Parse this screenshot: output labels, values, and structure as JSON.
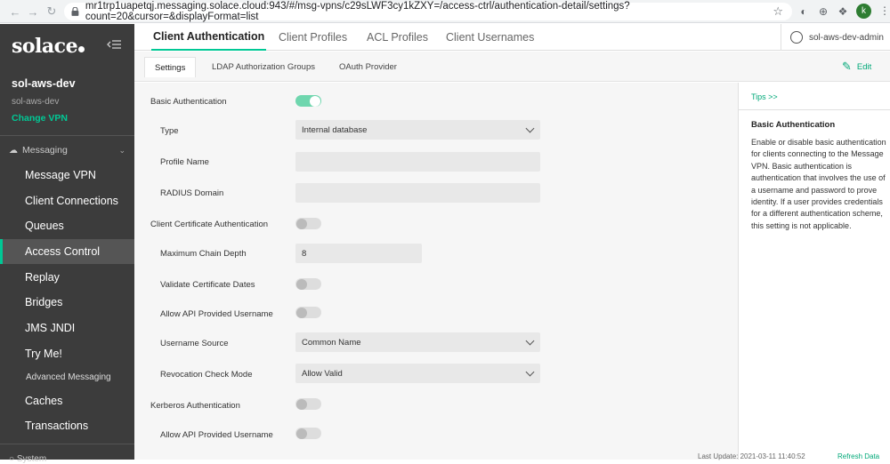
{
  "browser": {
    "url": "mr1trp1uapetqj.messaging.solace.cloud:943/#/msg-vpns/c29sLWF3cy1kZXY=/access-ctrl/authentication-detail/settings?count=20&cursor=&displayFormat=list",
    "profile_initial": "k"
  },
  "sidebar": {
    "logo": "solace",
    "vpn_name": "sol-aws-dev",
    "vpn_sub": "sol-aws-dev",
    "change_vpn": "Change VPN",
    "group_label": "Messaging",
    "items": [
      {
        "label": "Message VPN"
      },
      {
        "label": "Client Connections"
      },
      {
        "label": "Queues"
      },
      {
        "label": "Access Control"
      },
      {
        "label": "Replay"
      },
      {
        "label": "Bridges"
      },
      {
        "label": "JMS JNDI"
      },
      {
        "label": "Try Me!"
      },
      {
        "label": "Advanced Messaging"
      },
      {
        "label": "Caches"
      },
      {
        "label": "Transactions"
      }
    ],
    "system_label": "System"
  },
  "top_tabs": [
    {
      "label": "Client Authentication"
    },
    {
      "label": "Client Profiles"
    },
    {
      "label": "ACL Profiles"
    },
    {
      "label": "Client Usernames"
    }
  ],
  "user": {
    "name": "sol-aws-dev-admin"
  },
  "sub_tabs": [
    {
      "label": "Settings"
    },
    {
      "label": "LDAP Authorization Groups"
    },
    {
      "label": "OAuth Provider"
    }
  ],
  "edit_label": "Edit",
  "form": {
    "basic_auth": {
      "label": "Basic Authentication",
      "enabled": true
    },
    "type": {
      "label": "Type",
      "value": "Internal database"
    },
    "profile_name": {
      "label": "Profile Name",
      "value": ""
    },
    "radius_domain": {
      "label": "RADIUS Domain",
      "value": ""
    },
    "client_cert_auth": {
      "label": "Client Certificate Authentication",
      "enabled": false
    },
    "max_chain_depth": {
      "label": "Maximum Chain Depth",
      "value": "8"
    },
    "validate_cert_dates": {
      "label": "Validate Certificate Dates",
      "enabled": false
    },
    "allow_api_username": {
      "label": "Allow API Provided Username",
      "enabled": false
    },
    "username_source": {
      "label": "Username Source",
      "value": "Common Name"
    },
    "revocation_mode": {
      "label": "Revocation Check Mode",
      "value": "Allow Valid"
    },
    "kerberos_auth": {
      "label": "Kerberos Authentication",
      "enabled": false
    },
    "kerberos_allow_api_username": {
      "label": "Allow API Provided Username",
      "enabled": false
    }
  },
  "tips": {
    "link": "Tips >>",
    "title": "Basic Authentication",
    "body": "Enable or disable basic authentication for clients connecting to the Message VPN. Basic authentication is authentication that involves the use of a username and password to prove identity. If a user provides credentials for a different authentication scheme, this setting is not applicable."
  },
  "footer": {
    "last_update": "Last Update: 2021-03-11 11:40:52",
    "refresh": "Refresh Data"
  },
  "colors": {
    "accent": "#00c895",
    "sidebar_bg": "#3c3c3c",
    "toggle_on": "#6fd6ae"
  }
}
